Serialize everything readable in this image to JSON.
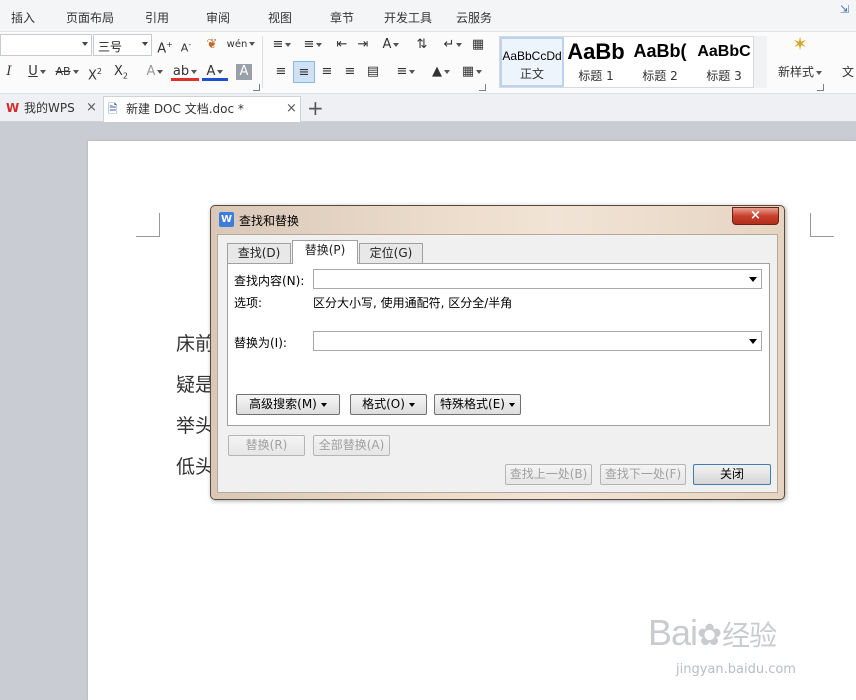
{
  "menu": [
    "插入",
    "页面布局",
    "引用",
    "审阅",
    "视图",
    "章节",
    "开发工具",
    "云服务"
  ],
  "ribbon": {
    "font_size": "三号",
    "style_gallery": [
      {
        "sample": "AaBbCcDd",
        "name": "正文"
      },
      {
        "sample": "AaBb",
        "name": "标题 1"
      },
      {
        "sample": "AaBb(",
        "name": "标题 2"
      },
      {
        "sample": "AaBbC",
        "name": "标题 3"
      }
    ],
    "new_style_label": "新样式",
    "cut_label": "文",
    "accent_color": "#3a6fb5",
    "highlight_color": "#e0302a",
    "font_color": "#1f4fd1"
  },
  "tabs": [
    {
      "label": "我的WPS"
    },
    {
      "label": "新建 DOC 文档.doc *"
    }
  ],
  "document": {
    "lines": [
      "床前",
      "疑是",
      "举头",
      "低头"
    ]
  },
  "dialog": {
    "title": "查找和替换",
    "tabs": [
      "查找(D)",
      "替换(P)",
      "定位(G)"
    ],
    "find_label": "查找内容(N):",
    "find_value": "",
    "options_label": "选项:",
    "options_value": "区分大小写, 使用通配符, 区分全/半角",
    "replace_label": "替换为(I):",
    "replace_value": "",
    "advanced_button": "高级搜索(M)",
    "format_button": "格式(O)",
    "special_button": "特殊格式(E)",
    "replace_button": "替换(R)",
    "replace_all_button": "全部替换(A)",
    "find_prev_button": "查找上一处(B)",
    "find_next_button": "查找下一处(F)",
    "close_button": "关闭"
  },
  "watermark": {
    "brand": "Bai",
    "brand_cn": "经验",
    "url": "jingyan.baidu.com"
  }
}
